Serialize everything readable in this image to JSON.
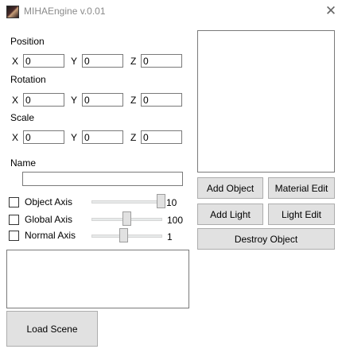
{
  "window": {
    "title": "MIHAEngine v.0.01",
    "app_icon": "app-portrait-icon",
    "close_glyph": "✕"
  },
  "transform": {
    "position": {
      "label": "Position",
      "x": "0",
      "y": "0",
      "z": "0"
    },
    "rotation": {
      "label": "Rotation",
      "x": "0",
      "y": "0",
      "z": "0"
    },
    "scale": {
      "label": "Scale",
      "x": "0",
      "y": "0",
      "z": "0"
    },
    "axis_labels": {
      "x": "X",
      "y": "Y",
      "z": "Z"
    }
  },
  "name": {
    "label": "Name",
    "value": ""
  },
  "axes": [
    {
      "label": "Object Axis",
      "checked": false,
      "value": "10",
      "slider_fraction": 1.0
    },
    {
      "label": "Global Axis",
      "checked": false,
      "value": "100",
      "slider_fraction": 0.5
    },
    {
      "label": "Normal Axis",
      "checked": false,
      "value": "1",
      "slider_fraction": 0.45
    }
  ],
  "buttons": {
    "add_object": "Add Object",
    "material_edit": "Material Edit",
    "add_light": "Add Light",
    "light_edit": "Light Edit",
    "destroy_object": "Destroy Object",
    "load_scene": "Load Scene"
  }
}
